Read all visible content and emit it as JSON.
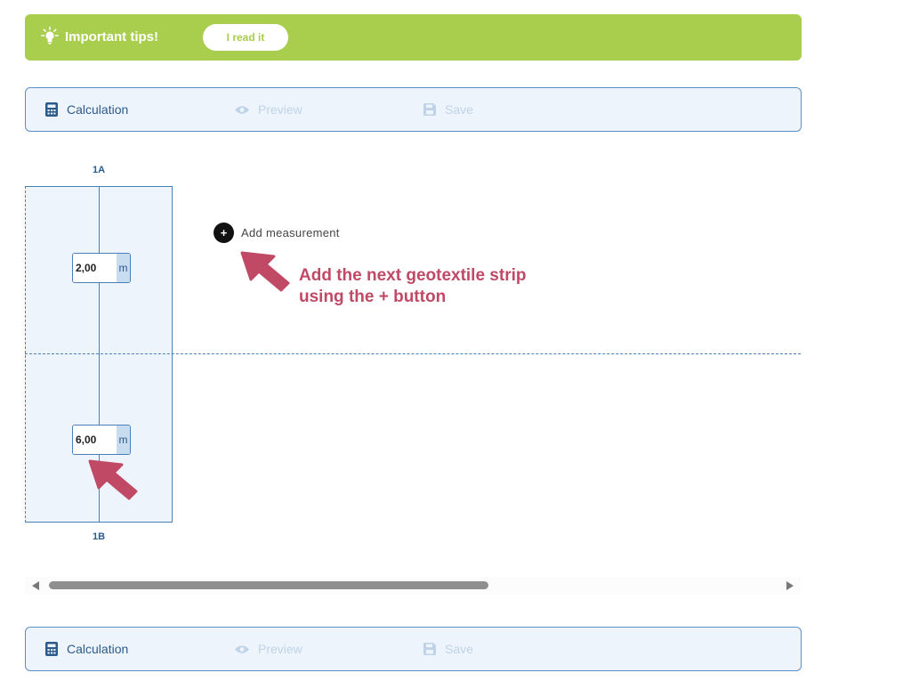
{
  "tips": {
    "title": "Important tips!",
    "button": "I read it",
    "icon": "lightbulb-icon"
  },
  "tabs": [
    {
      "label": "Calculation",
      "icon": "calculator-icon",
      "state": "active"
    },
    {
      "label": "Preview",
      "icon": "eye-icon",
      "state": "disabled"
    },
    {
      "label": "Save",
      "icon": "save-icon",
      "state": "disabled"
    }
  ],
  "canvas": {
    "strip_top_label": "1A",
    "strip_bottom_label": "1B",
    "measurements": [
      {
        "value": "2,00",
        "unit": "m"
      },
      {
        "value": "6,00",
        "unit": "m"
      }
    ],
    "add_button_symbol": "+",
    "add_measurement_label": "Add measurement"
  },
  "callout": {
    "text": "Add the next geotextile strip using the + button",
    "color": "#c04a66"
  },
  "colors": {
    "accent_green": "#a9cd4d",
    "accent_blue": "#2c5a8a",
    "callout": "#c04a66"
  }
}
